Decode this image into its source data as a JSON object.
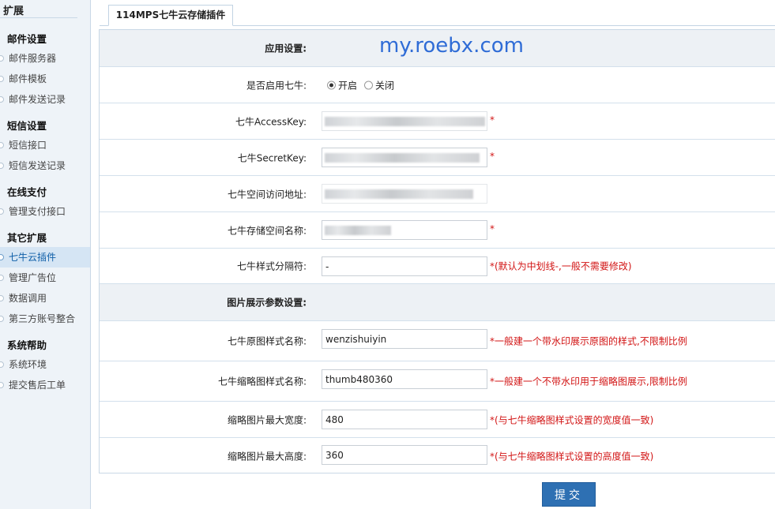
{
  "sidebar": {
    "title": "扩展",
    "groups": [
      {
        "title": "邮件设置",
        "items": [
          "邮件服务器",
          "邮件模板",
          "邮件发送记录"
        ]
      },
      {
        "title": "短信设置",
        "items": [
          "短信接口",
          "短信发送记录"
        ]
      },
      {
        "title": "在线支付",
        "items": [
          "管理支付接口"
        ]
      },
      {
        "title": "其它扩展",
        "items": [
          "七牛云插件",
          "管理广告位",
          "数据调用",
          "第三方账号整合"
        ]
      },
      {
        "title": "系统帮助",
        "items": [
          "系统环境",
          "提交售后工单"
        ]
      }
    ],
    "active_item": "七牛云插件"
  },
  "tab": {
    "label": "114MPS七牛云存储插件"
  },
  "watermark": "my.roebx.com",
  "form": {
    "section1": "应用设置:",
    "enable": {
      "label": "是否启用七牛:",
      "on_label": "开启",
      "off_label": "关闭",
      "selected": "开启"
    },
    "access_key": {
      "label": "七牛AccessKey:",
      "required": "*"
    },
    "secret_key": {
      "label": "七牛SecretKey:",
      "required": "*"
    },
    "space_url": {
      "label": "七牛空间访问地址:"
    },
    "space_name": {
      "label": "七牛存储空间名称:",
      "required": "*"
    },
    "separator": {
      "label": "七牛样式分隔符:",
      "value": "-",
      "note": "*(默认为中划线-,一般不需要修改)"
    },
    "section2": "图片展示参数设置:",
    "orig_style": {
      "label": "七牛原图样式名称:",
      "value": "wenzishuiyin",
      "note": "*一般建一个带水印展示原图的样式,不限制比例"
    },
    "thumb_style": {
      "label": "七牛缩略图样式名称:",
      "value": "thumb480360",
      "note": "*一般建一个不带水印用于缩略图展示,限制比例"
    },
    "max_width": {
      "label": "缩略图片最大宽度:",
      "value": "480",
      "note": "*(与七牛缩略图样式设置的宽度值一致)"
    },
    "max_height": {
      "label": "缩略图片最大高度:",
      "value": "360",
      "note": "*(与七牛缩略图样式设置的高度值一致)"
    }
  },
  "submit_label": "提交"
}
